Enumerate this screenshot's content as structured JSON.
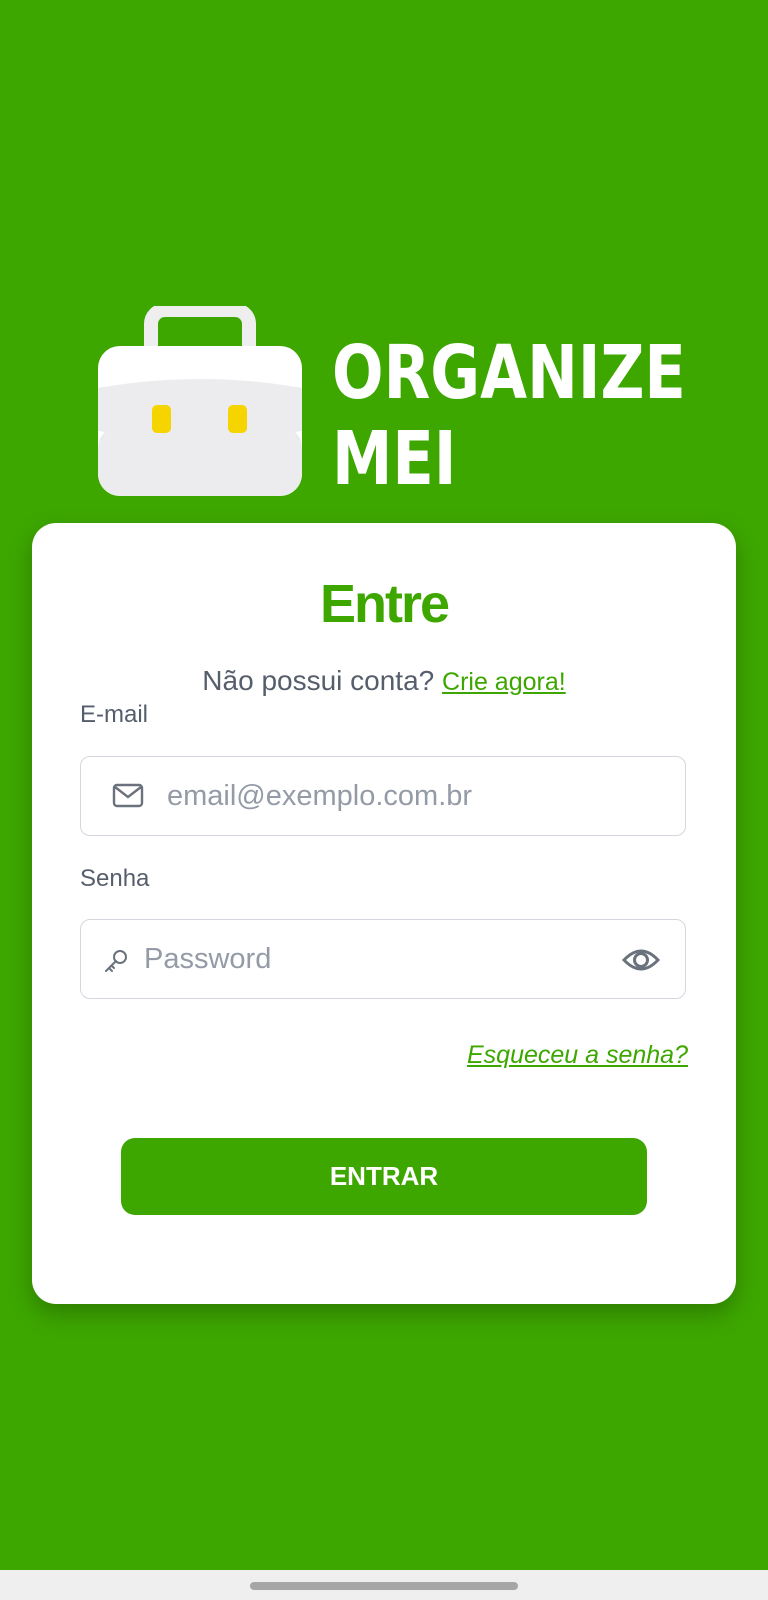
{
  "brand": {
    "line1": "ORGANIZE",
    "line2": "MEI",
    "logo_icon": "briefcase-icon"
  },
  "login": {
    "title": "Entre",
    "signup_prompt": "Não possui conta?",
    "signup_link": "Crie agora!",
    "email_label": "E-mail",
    "email_placeholder": "email@exemplo.com.br",
    "email_value": "",
    "password_label": "Senha",
    "password_placeholder": "Password",
    "password_value": "",
    "forgot_password": "Esqueceu a senha?",
    "submit_label": "ENTRAR"
  },
  "icons": {
    "email": "mail-icon",
    "password": "key-icon",
    "toggle_visibility": "eye-icon"
  },
  "colors": {
    "primary": "#3da700",
    "card": "#ffffff",
    "text_muted": "#565e6c",
    "placeholder": "#959ba6",
    "briefcase_latch": "#f5d400"
  }
}
